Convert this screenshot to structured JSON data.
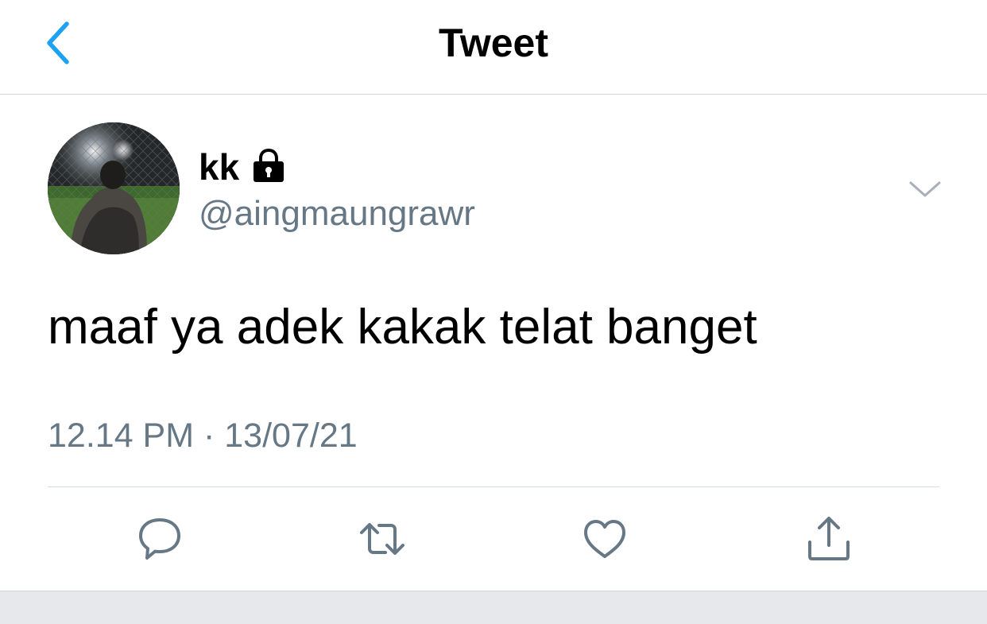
{
  "header": {
    "title": "Tweet",
    "back_icon": "chevron-left-icon",
    "accent_color": "#1da1f2"
  },
  "tweet": {
    "author": {
      "display_name": "kk",
      "protected_icon": "lock-icon",
      "handle": "@aingmaungrawr"
    },
    "text": "maaf ya adek kakak telat banget",
    "timestamp": "12.14 PM · 13/07/21",
    "menu_icon": "chevron-down-icon"
  },
  "actions": [
    {
      "icon": "reply-icon"
    },
    {
      "icon": "retweet-icon"
    },
    {
      "icon": "like-icon"
    },
    {
      "icon": "share-icon"
    }
  ],
  "colors": {
    "text": "#000000",
    "secondary_text": "#667785",
    "icon": "#667785",
    "divider": "#d6dbdf",
    "bottom_bar": "#e6e8eb"
  }
}
